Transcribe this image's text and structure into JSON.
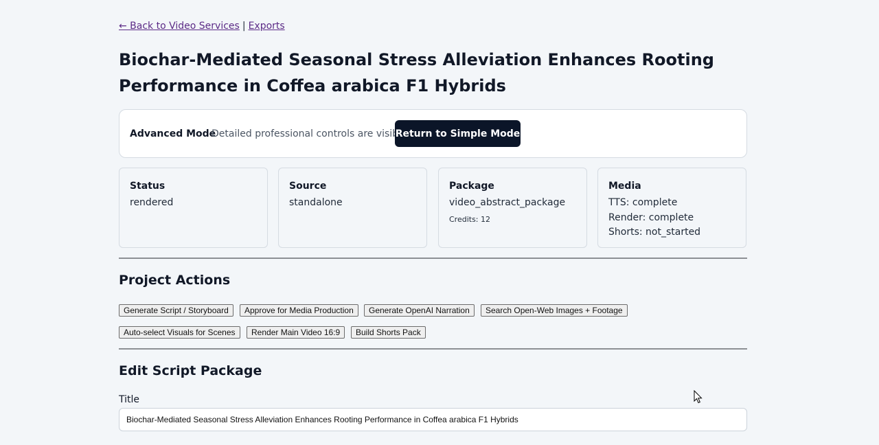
{
  "nav": {
    "back_link": "← Back to Video Services",
    "separator": "|",
    "exports_link": "Exports"
  },
  "page_title": "Biochar-Mediated Seasonal Stress Alleviation Enhances Rooting Performance in Coffea arabica F1 Hybrids",
  "mode_bar": {
    "label": "Advanced Mode",
    "description": "Detailed professional controls are visible.",
    "button": "Return to Simple Mode"
  },
  "stats": {
    "status": {
      "label": "Status",
      "value": "rendered"
    },
    "source": {
      "label": "Source",
      "value": "standalone"
    },
    "package": {
      "label": "Package",
      "value": "video_abstract_package",
      "credits": "Credits: 12"
    },
    "media": {
      "label": "Media",
      "tts": "TTS: complete",
      "render": "Render: complete",
      "shorts": "Shorts: not_started"
    }
  },
  "project_actions": {
    "heading": "Project Actions",
    "buttons": [
      "Generate Script / Storyboard",
      "Approve for Media Production",
      "Generate OpenAI Narration",
      "Search Open-Web Images + Footage",
      "Auto-select Visuals for Scenes",
      "Render Main Video 16:9",
      "Build Shorts Pack"
    ]
  },
  "edit_script": {
    "heading": "Edit Script Package",
    "title_label": "Title",
    "title_value": "Biochar-Mediated Seasonal Stress Alleviation Enhances Rooting Performance in Coffea arabica F1 Hybrids"
  },
  "colors": {
    "page_bg": "#f3f6f9",
    "primary_button": "#0b1528",
    "link": "#5b2a86"
  }
}
